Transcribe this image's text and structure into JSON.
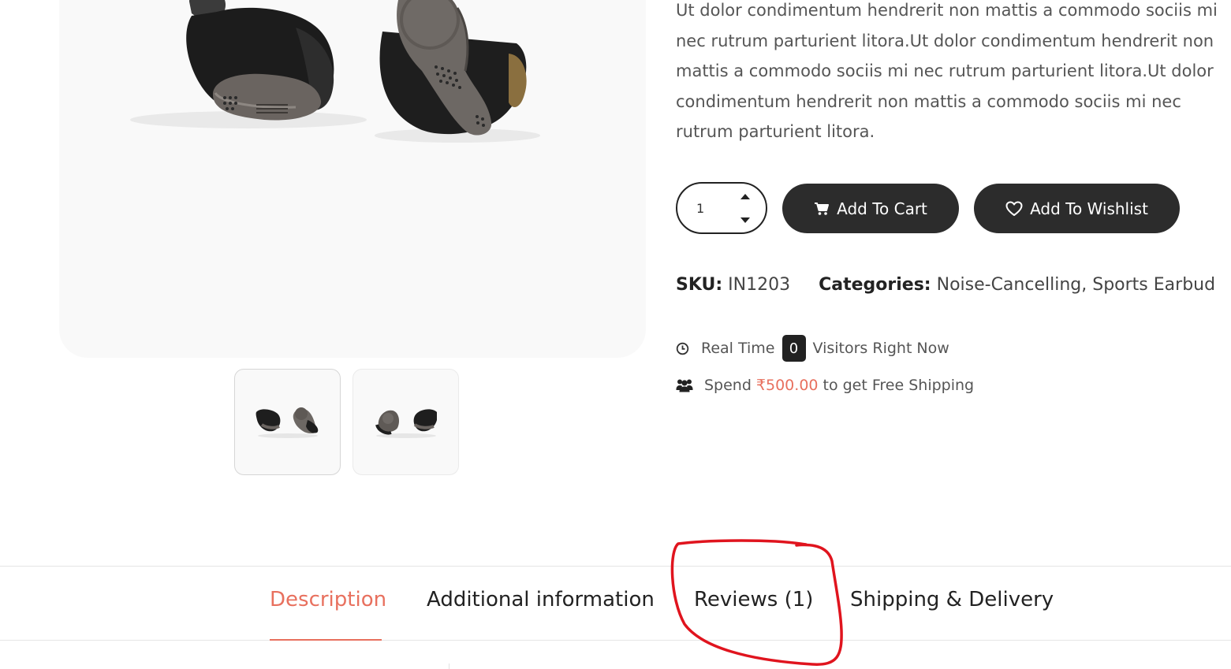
{
  "product": {
    "description_lines": [
      "Ut dolor condimentum hendrerit non mattis a commodo sociis mi",
      "nec rutrum parturient litora.Ut dolor condimentum hendrerit non",
      "mattis a commodo sociis mi nec rutrum parturient litora.Ut dolor",
      "condimentum hendrerit non mattis a commodo sociis mi nec",
      "rutrum parturient litora."
    ],
    "quantity": "1",
    "add_to_cart_label": "Add To Cart",
    "add_to_wishlist_label": "Add To Wishlist",
    "sku_label": "SKU:",
    "sku_value": "IN1203",
    "categories_label": "Categories:",
    "categories": [
      "Noise-Cancelling",
      "Sports Earbud"
    ],
    "categories_separator": ", "
  },
  "realtime": {
    "prefix": "Real Time",
    "count": "0",
    "suffix": "Visitors Right Now"
  },
  "shipping_notice": {
    "prefix": "Spend",
    "amount": "₹500.00",
    "suffix": "to get Free Shipping"
  },
  "tabs": [
    {
      "label": "Description",
      "active": true
    },
    {
      "label": "Additional information",
      "active": false
    },
    {
      "label": "Reviews (1)",
      "active": false
    },
    {
      "label": "Shipping & Delivery",
      "active": false
    }
  ],
  "icons": {
    "cart": "cart-icon",
    "wishlist": "heart-icon",
    "clock": "clock-icon",
    "users": "users-icon",
    "spinner_up": "caret-up-icon",
    "spinner_down": "caret-down-icon"
  },
  "colors": {
    "accent": "#e8705e",
    "button_bg": "#2c2c2c",
    "annotation": "#e0141e"
  }
}
